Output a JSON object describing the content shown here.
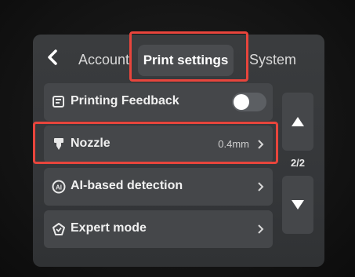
{
  "tabs": {
    "account": "Account",
    "print_settings": "Print settings",
    "system": "System"
  },
  "settings": {
    "printing_feedback": {
      "label": "Printing Feedback",
      "toggle_on": false
    },
    "nozzle": {
      "label": "Nozzle",
      "value": "0.4mm"
    },
    "ai_detection": {
      "label": "AI-based detection"
    },
    "expert_mode": {
      "label": "Expert mode"
    }
  },
  "pager": {
    "text": "2/2"
  },
  "icons": [
    "back-arrow-icon",
    "feedback-icon",
    "nozzle-icon",
    "ai-icon",
    "expert-icon",
    "chevron-right-icon",
    "arrow-up-icon",
    "arrow-down-icon"
  ],
  "colors": {
    "highlight": "#e8453c",
    "panel": "#45474a",
    "screen": "#37393c"
  }
}
